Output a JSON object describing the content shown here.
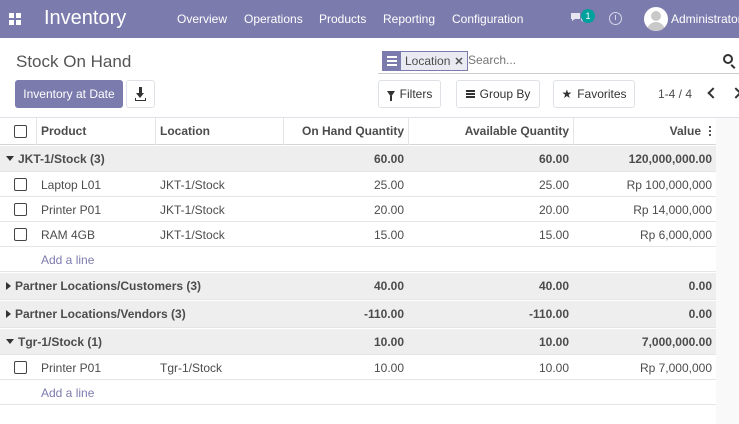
{
  "navbar": {
    "brand": "Inventory",
    "menus": [
      "Overview",
      "Operations",
      "Products",
      "Reporting",
      "Configuration"
    ],
    "chat_badge": "1",
    "user": "Administrator",
    "color": "#7c7bad"
  },
  "control": {
    "title": "Stock On Hand",
    "inventory_at_date": "Inventory at Date",
    "facet_label": "Location",
    "search_placeholder": "Search...",
    "filters": "Filters",
    "group_by": "Group By",
    "favorites": "Favorites",
    "pager": "1-4 / 4"
  },
  "table": {
    "columns": {
      "product": "Product",
      "location": "Location",
      "on_hand": "On Hand Quantity",
      "available": "Available Quantity",
      "value": "Value"
    },
    "add_line": "Add a line",
    "groups": [
      {
        "name": "JKT-1/Stock (3)",
        "expanded": true,
        "on_hand": "60.00",
        "available": "60.00",
        "value": "120,000,000.00",
        "rows": [
          {
            "product": "Laptop L01",
            "location": "JKT-1/Stock",
            "on_hand": "25.00",
            "available": "25.00",
            "value": "Rp 100,000,000"
          },
          {
            "product": "Printer P01",
            "location": "JKT-1/Stock",
            "on_hand": "20.00",
            "available": "20.00",
            "value": "Rp 14,000,000"
          },
          {
            "product": "RAM 4GB",
            "location": "JKT-1/Stock",
            "on_hand": "15.00",
            "available": "15.00",
            "value": "Rp 6,000,000"
          }
        ]
      },
      {
        "name": "Partner Locations/Customers (3)",
        "expanded": false,
        "on_hand": "40.00",
        "available": "40.00",
        "value": "0.00",
        "rows": []
      },
      {
        "name": "Partner Locations/Vendors (3)",
        "expanded": false,
        "on_hand": "-110.00",
        "available": "-110.00",
        "value": "0.00",
        "rows": []
      },
      {
        "name": "Tgr-1/Stock (1)",
        "expanded": true,
        "on_hand": "10.00",
        "available": "10.00",
        "value": "7,000,000.00",
        "rows": [
          {
            "product": "Printer P01",
            "location": "Tgr-1/Stock",
            "on_hand": "10.00",
            "available": "10.00",
            "value": "Rp 7,000,000"
          }
        ]
      }
    ]
  }
}
